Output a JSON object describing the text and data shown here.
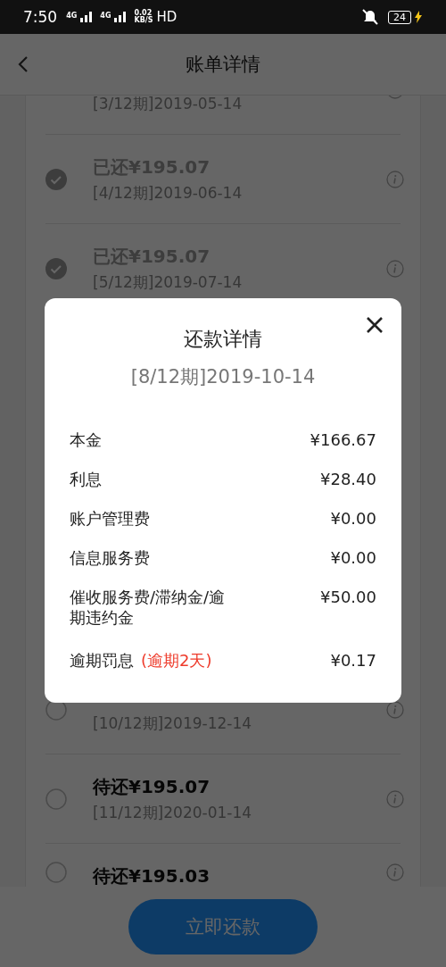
{
  "status_bar": {
    "time": "7:50",
    "network_1": "4G",
    "network_2": "4G",
    "speed_value": "0.02",
    "speed_unit": "KB/S",
    "hd": "HD",
    "battery": "24",
    "charging": true
  },
  "header": {
    "title": "账单详情"
  },
  "installments_above_dialog": [
    {
      "period": "[3/12期]2019-05-14"
    },
    {
      "title": "已还¥195.07",
      "period": "[4/12期]2019-06-14",
      "paid": true
    },
    {
      "title": "已还¥195.07",
      "period": "[5/12期]2019-07-14",
      "paid": true
    }
  ],
  "installments_below_dialog": [
    {
      "period": "[10/12期]2019-12-14",
      "paid": false
    },
    {
      "title": "待还¥195.07",
      "period": "[11/12期]2020-01-14",
      "paid": false
    },
    {
      "title": "待还¥195.03",
      "paid": false
    }
  ],
  "pay_button": "立即还款",
  "dialog": {
    "title": "还款详情",
    "subtitle": "[8/12期]2019-10-14",
    "items": [
      {
        "label": "本金",
        "value": "¥166.67"
      },
      {
        "label": "利息",
        "value": "¥28.40"
      },
      {
        "label": "账户管理费",
        "value": "¥0.00"
      },
      {
        "label": "信息服务费",
        "value": "¥0.00"
      },
      {
        "label": "催收服务费/滞纳金/逾期违约金",
        "value": "¥50.00"
      },
      {
        "label": "逾期罚息",
        "note": "(逾期2天)",
        "value": "¥0.17"
      }
    ]
  }
}
